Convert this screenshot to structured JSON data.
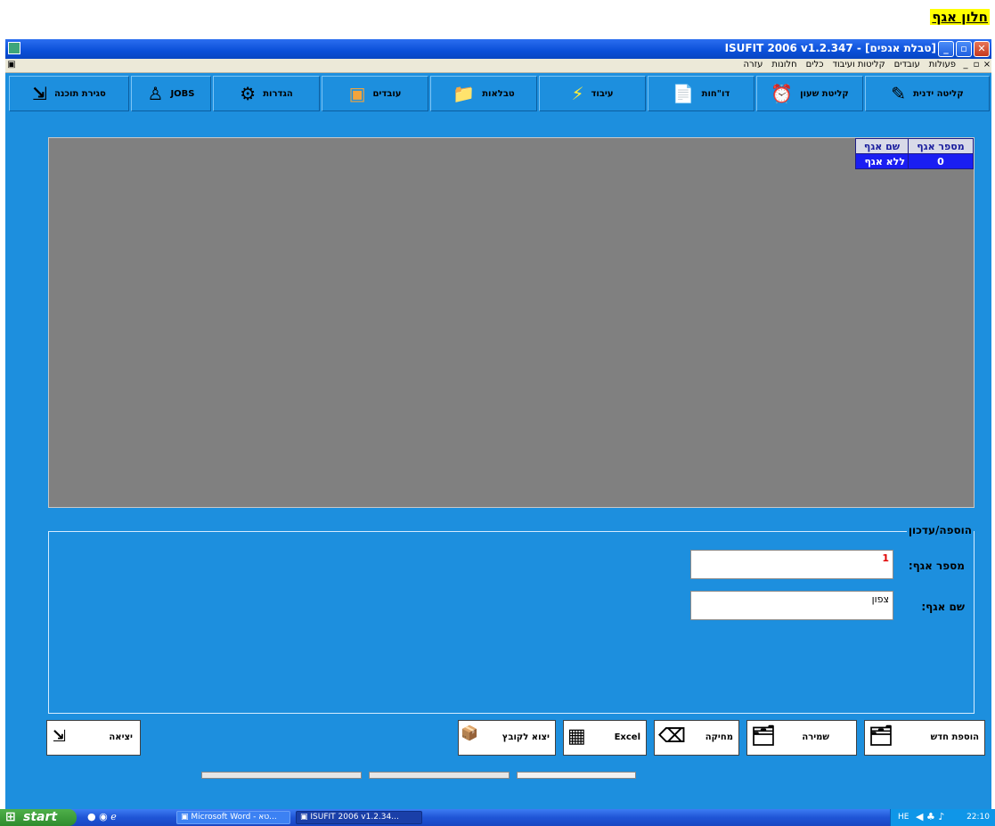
{
  "doc_heading": "חלון אגף",
  "window": {
    "title": "ISUFIT 2006  v1.2.347 - [טבלת אגפים]",
    "controls": {
      "minimize": "_",
      "maximize": "▫",
      "close": "✕"
    }
  },
  "menu": {
    "items": [
      "פעולות",
      "עובדים",
      "קליטות ועיבוד",
      "כלים",
      "חלונות",
      "עזרה"
    ],
    "mdi": {
      "close": "×",
      "restore": "▫",
      "minimize": "_"
    }
  },
  "toolbar": [
    {
      "label": "קליטה ידנית",
      "icon": "pencil-icon",
      "glyph": "✎"
    },
    {
      "label": "קליטת שעון",
      "icon": "clock-icon",
      "glyph": "⏰"
    },
    {
      "label": "דו\"חות",
      "icon": "report-icon",
      "glyph": "📄"
    },
    {
      "label": "עיבוד",
      "icon": "lightning-icon",
      "glyph": "⚡"
    },
    {
      "label": "טבלאות",
      "icon": "folder-icon",
      "glyph": "📁"
    },
    {
      "label": "עובדים",
      "icon": "worker-icon",
      "glyph": "▣"
    },
    {
      "label": "הגדרות",
      "icon": "settings-icon",
      "glyph": "⚙"
    },
    {
      "label": "JOBS",
      "icon": "person-icon",
      "glyph": "♙"
    },
    {
      "label": "סגירת תוכנה",
      "icon": "exit-icon",
      "glyph": "⇲"
    }
  ],
  "grid": {
    "headers": [
      "מספר אגף",
      "שם אגף"
    ],
    "rows": [
      {
        "number": "0",
        "name": "ללא אגף"
      }
    ]
  },
  "edit": {
    "legend": "הוספה/עדכון",
    "number_label": "מספר אגף:",
    "number_value": "1",
    "name_label": "שם אגף:",
    "name_value": "צפון"
  },
  "buttons": {
    "add_new": "הוספת חדש",
    "save": "שמירה",
    "delete": "מחיקה",
    "excel": "Excel",
    "export": "יצוא לקובץ",
    "exit": "יציאה"
  },
  "taskbar": {
    "start": "start",
    "tasks": [
      "Microsoft Word - טא...",
      "ISUFIT 2006  v1.2.34..."
    ],
    "lang": "HE",
    "clock": "22:10"
  },
  "colors": {
    "app_background": "#1d8fde",
    "grid_background": "#808080",
    "selected_row": "#1a1ef2",
    "titlebar": "#0a4fd8",
    "number_value": "#e00000"
  }
}
